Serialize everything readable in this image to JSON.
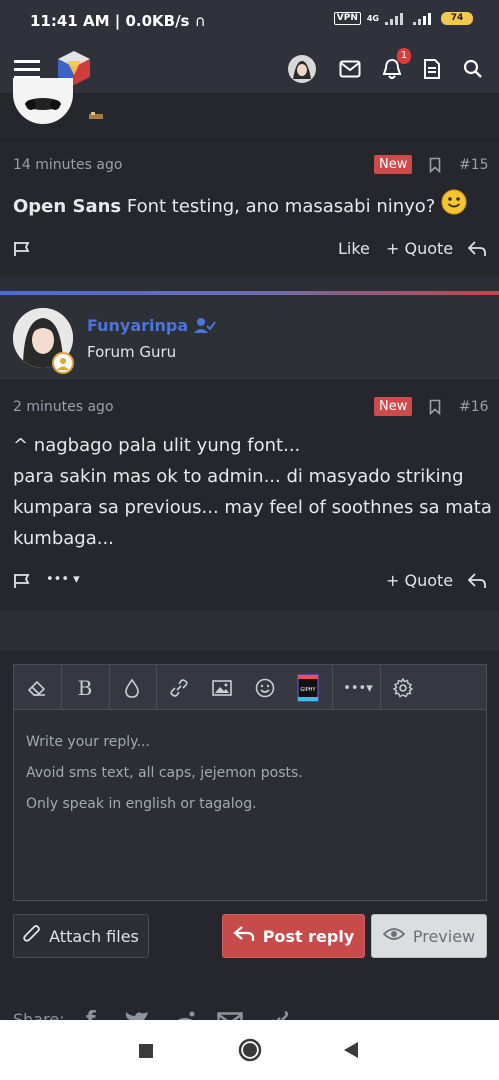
{
  "status_bar": {
    "time": "11:41 AM",
    "speed": "0.0KB/s",
    "vpn": "VPN",
    "network": "4G",
    "battery": "74"
  },
  "post_15": {
    "time": "14 minutes ago",
    "badge": "New",
    "number": "#15",
    "font_name": "Open Sans",
    "text": "Font testing, ano masasabi ninyo?",
    "like_label": "Like",
    "quote_label": "Quote"
  },
  "post_16": {
    "username": "Funyarinpa",
    "user_title": "Forum Guru",
    "time": "2 minutes ago",
    "badge": "New",
    "number": "#16",
    "lines": [
      "^ nagbago pala ulit yung font...",
      "para sakin mas ok to admin... di masyado striking",
      "kumpara sa previous... may feel of soothnes sa mata",
      "kumbaga..."
    ],
    "more_label": "•••",
    "quote_label": "Quote"
  },
  "editor": {
    "placeholder_lines": [
      "Write your reply...",
      "Avoid sms text, all caps, jejemon posts.",
      "Only speak in english or tagalog."
    ],
    "bold_label": "B",
    "more_label": "•••",
    "gif_label": "GIPHY"
  },
  "buttons": {
    "attach": "Attach files",
    "post_reply": "Post reply",
    "preview": "Preview"
  },
  "share": {
    "label": "Share:"
  },
  "notifications": {
    "count": "1"
  },
  "colors": {
    "accent_blue": "#4f74d9",
    "badge_red": "#cf4a4a",
    "post_reply_red": "#c84b4b"
  }
}
